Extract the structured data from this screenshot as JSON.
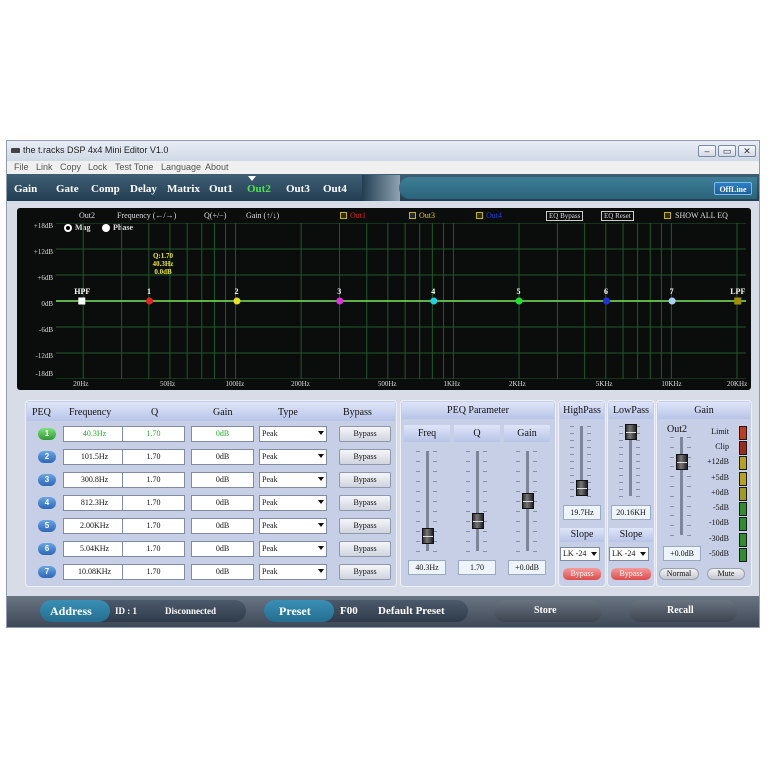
{
  "window": {
    "title": "the t.racks DSP 4x4 Mini Editor V1.0",
    "controls": [
      "‒",
      "▭",
      "✕"
    ]
  },
  "menu": [
    "File",
    "Link",
    "Copy",
    "Lock",
    "Test Tone",
    "Language",
    "About"
  ],
  "tabs": [
    "Gain",
    "Gate",
    "Comp",
    "Delay",
    "Matrix",
    "Out1",
    "Out2",
    "Out3",
    "Out4"
  ],
  "active_tab": "Out2",
  "status": {
    "offline": "OffLine"
  },
  "graph": {
    "header": {
      "channel": "Out2",
      "frequency": "Frequency (←/→)",
      "q": "Q(+/−)",
      "gain": "Gain (↑/↓)",
      "overlays": [
        {
          "label": "Out1",
          "color": "#e02020"
        },
        {
          "label": "Out3",
          "color": "#e8d000"
        },
        {
          "label": "Out4",
          "color": "#2040e0"
        }
      ],
      "eq_bypass": "EQ Bypass",
      "eq_reset": "EQ Reset",
      "show_all": "SHOW ALL EQ"
    },
    "view_modes": {
      "mag": "Mag",
      "phase": "Phase",
      "selected": "Mag"
    },
    "y_ticks": [
      "+18dB",
      "+12dB",
      "+6dB",
      "0dB",
      "-6dB",
      "-12dB",
      "-18dB"
    ],
    "x_ticks": [
      "20Hz",
      "50Hz",
      "100Hz",
      "200Hz",
      "500Hz",
      "1KHz",
      "2KHz",
      "5KHz",
      "10KHz",
      "20KHz"
    ],
    "points": [
      {
        "label": "HPF",
        "freq": 19.7,
        "color": "#ffffff",
        "shape": "square"
      },
      {
        "label": "1",
        "freq": 40.3,
        "color": "#e52222",
        "shape": "circle"
      },
      {
        "label": "2",
        "freq": 101.5,
        "color": "#e8e020",
        "shape": "circle"
      },
      {
        "label": "3",
        "freq": 300.8,
        "color": "#e030e0",
        "shape": "circle"
      },
      {
        "label": "4",
        "freq": 812.3,
        "color": "#20d0e0",
        "shape": "circle"
      },
      {
        "label": "5",
        "freq": 2000,
        "color": "#20e030",
        "shape": "circle"
      },
      {
        "label": "6",
        "freq": 5040,
        "color": "#2030e0",
        "shape": "circle"
      },
      {
        "label": "7",
        "freq": 10080,
        "color": "#a8d0f8",
        "shape": "circle"
      },
      {
        "label": "LPF",
        "freq": 20160,
        "color": "#a09000",
        "shape": "square"
      }
    ],
    "selected_info": [
      "Q:1.70",
      "40.3Hz",
      "0.0dB"
    ]
  },
  "peq": {
    "headers": [
      "PEQ",
      "Frequency",
      "Q",
      "Gain",
      "Type",
      "Bypass"
    ],
    "rows": [
      {
        "num": "1",
        "freq": "40.3Hz",
        "q": "1.70",
        "gain": "0dB",
        "type": "Peak",
        "bypass": "Bypass"
      },
      {
        "num": "2",
        "freq": "101.5Hz",
        "q": "1.70",
        "gain": "0dB",
        "type": "Peak",
        "bypass": "Bypass"
      },
      {
        "num": "3",
        "freq": "300.8Hz",
        "q": "1.70",
        "gain": "0dB",
        "type": "Peak",
        "bypass": "Bypass"
      },
      {
        "num": "4",
        "freq": "812.3Hz",
        "q": "1.70",
        "gain": "0dB",
        "type": "Peak",
        "bypass": "Bypass"
      },
      {
        "num": "5",
        "freq": "2.00KHz",
        "q": "1.70",
        "gain": "0dB",
        "type": "Peak",
        "bypass": "Bypass"
      },
      {
        "num": "6",
        "freq": "5.04KHz",
        "q": "1.70",
        "gain": "0dB",
        "type": "Peak",
        "bypass": "Bypass"
      },
      {
        "num": "7",
        "freq": "10.08KHz",
        "q": "1.70",
        "gain": "0dB",
        "type": "Peak",
        "bypass": "Bypass"
      }
    ]
  },
  "peq_param": {
    "title": "PEQ Parameter",
    "freq_label": "Freq",
    "freq_value": "40.3Hz",
    "freq_level": 0.15,
    "q_label": "Q",
    "q_value": "1.70",
    "q_level": 0.3,
    "gain_label": "Gain",
    "gain_value": "+0.0dB",
    "gain_level": 0.5
  },
  "highpass": {
    "title": "HighPass",
    "value": "19.7Hz",
    "level": 0.12,
    "slope_title": "Slope",
    "slope": "LK -24",
    "bypass": "Bypass"
  },
  "lowpass": {
    "title": "LowPass",
    "value": "20.16KH",
    "level": 0.92,
    "slope_title": "Slope",
    "slope": "LK -24",
    "bypass": "Bypass"
  },
  "gain": {
    "title": "Gain",
    "channel": "Out2",
    "value": "+0.0dB",
    "level": 0.75,
    "meter_labels": [
      "Limit",
      "Clip",
      "+12dB",
      "+5dB",
      "+0dB",
      "-5dB",
      "-10dB",
      "-30dB",
      "-50dB"
    ],
    "normal": "Normal",
    "mute": "Mute"
  },
  "bottom": {
    "address": "Address",
    "id": "ID : 1",
    "connection": "Disconnected",
    "preset": "Preset",
    "preset_code": "F00",
    "preset_name": "Default Preset",
    "store": "Store",
    "recall": "Recall"
  }
}
